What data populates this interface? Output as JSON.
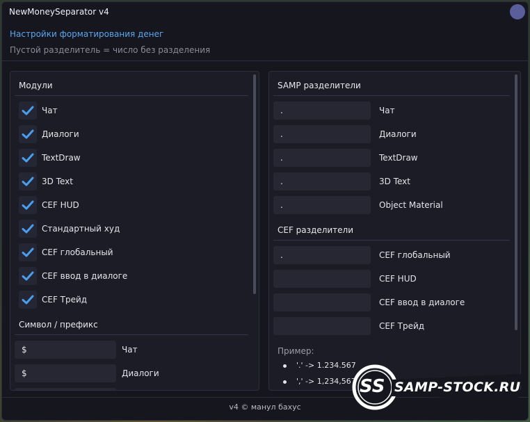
{
  "window": {
    "title": "NewMoneySeparator v4"
  },
  "header": {
    "subtitle": "Настройки форматирования денег",
    "hint": "Пустой разделитель = число без разделения"
  },
  "modules": {
    "heading": "Модули",
    "items": [
      {
        "label": "Чат",
        "checked": true
      },
      {
        "label": "Диалоги",
        "checked": true
      },
      {
        "label": "TextDraw",
        "checked": true
      },
      {
        "label": "3D Text",
        "checked": true
      },
      {
        "label": "CEF HUD",
        "checked": true
      },
      {
        "label": "Стандартный худ",
        "checked": true
      },
      {
        "label": "CEF глобальный",
        "checked": true
      },
      {
        "label": "CEF ввод в диалоге",
        "checked": true
      },
      {
        "label": "CEF Трейд",
        "checked": true
      }
    ]
  },
  "prefix": {
    "heading": "Символ / префикс",
    "items": [
      {
        "value": "$",
        "label": "Чат"
      },
      {
        "value": "$",
        "label": "Диалоги"
      }
    ]
  },
  "samp": {
    "heading": "SAMP разделители",
    "items": [
      {
        "value": ".",
        "label": "Чат"
      },
      {
        "value": ".",
        "label": "Диалоги"
      },
      {
        "value": ".",
        "label": "TextDraw"
      },
      {
        "value": ".",
        "label": "3D Text"
      },
      {
        "value": ".",
        "label": "Object Material"
      }
    ]
  },
  "cef": {
    "heading": "CEF разделители",
    "items": [
      {
        "value": ".",
        "label": "CEF глобальный"
      },
      {
        "value": "",
        "label": "CEF HUD"
      },
      {
        "value": "",
        "label": "CEF ввод в диалоге"
      },
      {
        "value": "",
        "label": "CEF Трейд"
      }
    ]
  },
  "example": {
    "heading": "Пример:",
    "items": [
      "'.' -> 1.234.567",
      "',' -> 1,234,567"
    ]
  },
  "footer": {
    "text": "v4 © манул бахус"
  },
  "watermark": {
    "text": "SAMP-STOCK.RU",
    "badge": "SS"
  },
  "colors": {
    "accent": "#5aa6f0",
    "check": "#4a9ff0",
    "background": "#15161e"
  }
}
